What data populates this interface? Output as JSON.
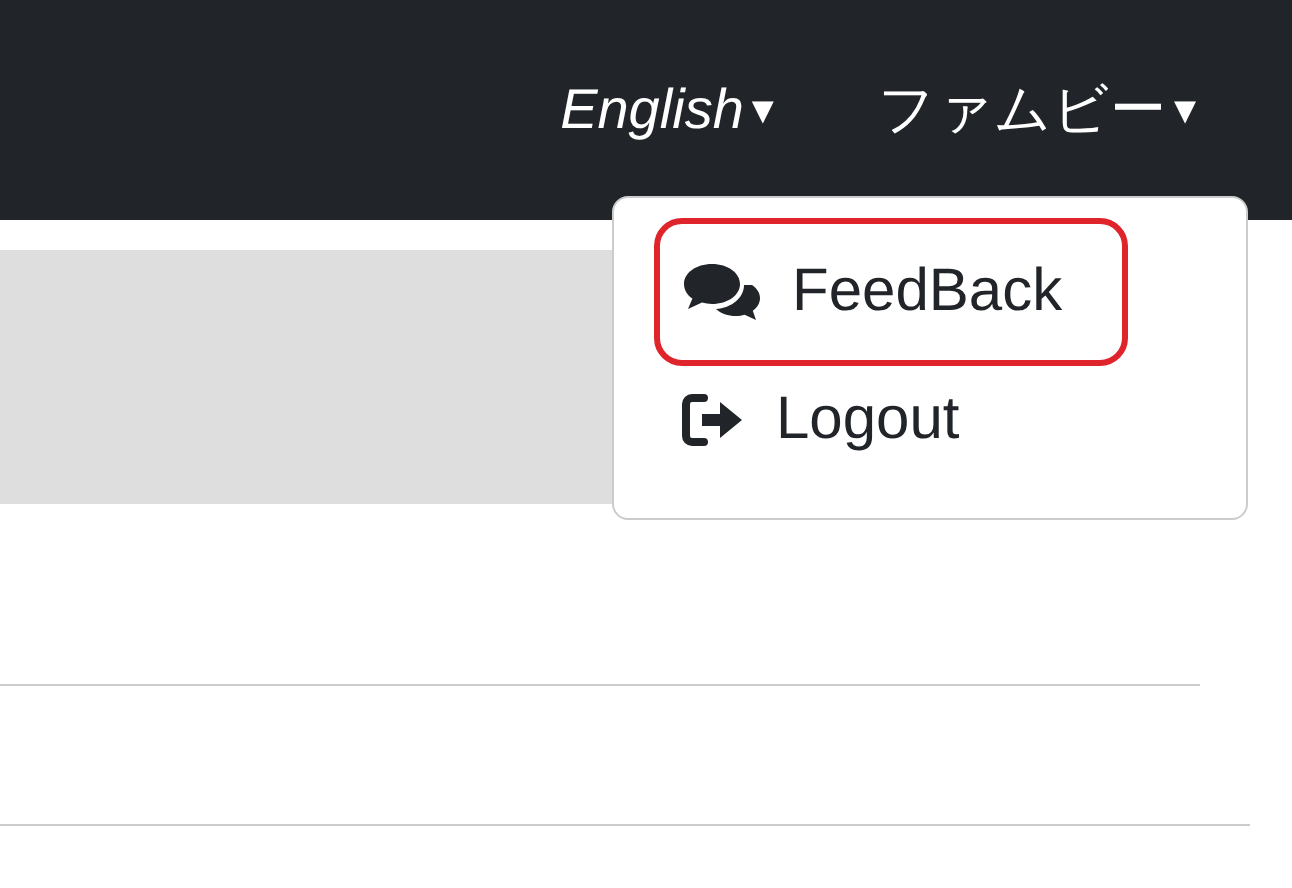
{
  "navbar": {
    "language_menu": {
      "label": "English",
      "caret": "▾"
    },
    "user_menu": {
      "label": "ファムビー",
      "caret": "▾",
      "expanded": true
    }
  },
  "dropdown": {
    "items": [
      {
        "kind": "feedback",
        "label": "FeedBack",
        "highlighted": true
      },
      {
        "kind": "logout",
        "label": "Logout",
        "highlighted": false
      }
    ]
  }
}
